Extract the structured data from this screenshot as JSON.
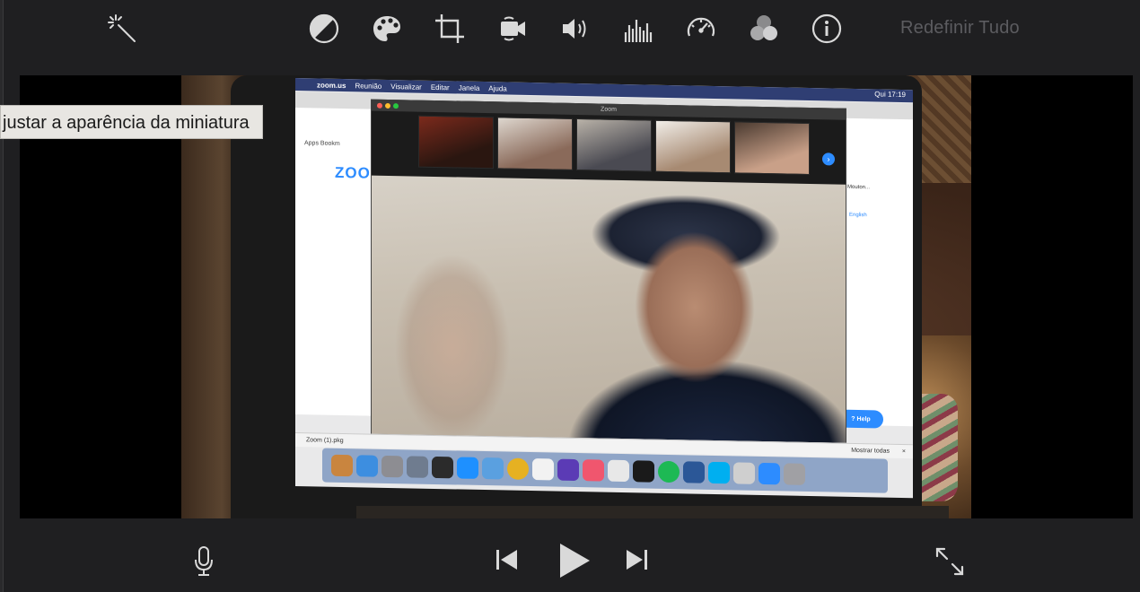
{
  "toolbar": {
    "tools": [
      {
        "name": "magic-wand-icon",
        "label": "Aprimorar"
      },
      {
        "name": "color-balance-icon",
        "label": "Equilíbrio de cores"
      },
      {
        "name": "color-palette-icon",
        "label": "Correção de cor"
      },
      {
        "name": "crop-icon",
        "label": "Recortar"
      },
      {
        "name": "video-stabilization-icon",
        "label": "Estabilização"
      },
      {
        "name": "volume-icon",
        "label": "Volume"
      },
      {
        "name": "equalizer-icon",
        "label": "Redução de ruído e equalizador"
      },
      {
        "name": "speedometer-icon",
        "label": "Velocidade"
      },
      {
        "name": "clip-filter-icon",
        "label": "Filtro de clipe"
      },
      {
        "name": "info-icon",
        "label": "Informações"
      }
    ],
    "reset_label": "Redefinir Tudo"
  },
  "tooltip": {
    "text": "justar a aparência da miniatura"
  },
  "video": {
    "menubar": {
      "app": "zoom.us",
      "items": [
        "Reunião",
        "Visualizar",
        "Editar",
        "Janela",
        "Ajuda"
      ],
      "clock": "Qui 17:19"
    },
    "zoom_window_title": "Zoom",
    "browser_bookmarks": "Apps   Bookm",
    "zoom_logo": "ZOO",
    "side_text": "Mouton...",
    "english_link": "English",
    "help_button": "Help",
    "download_file": "Zoom (1).pkg",
    "show_all": "Mostrar todas",
    "close_x": "×"
  },
  "colors": {
    "background": "#1f1f21",
    "icon": "#d9d9d9",
    "reset_text": "#5c5c60",
    "tooltip_bg": "#e8e6e2",
    "zoom_blue": "#2d8cff"
  },
  "bottom_controls": [
    {
      "name": "microphone-icon",
      "label": "Gravar narração"
    },
    {
      "name": "skip-back-icon",
      "label": "Voltar ao início"
    },
    {
      "name": "play-icon",
      "label": "Reproduzir"
    },
    {
      "name": "skip-forward-icon",
      "label": "Avançar ao fim"
    },
    {
      "name": "fullscreen-icon",
      "label": "Tela cheia"
    }
  ]
}
